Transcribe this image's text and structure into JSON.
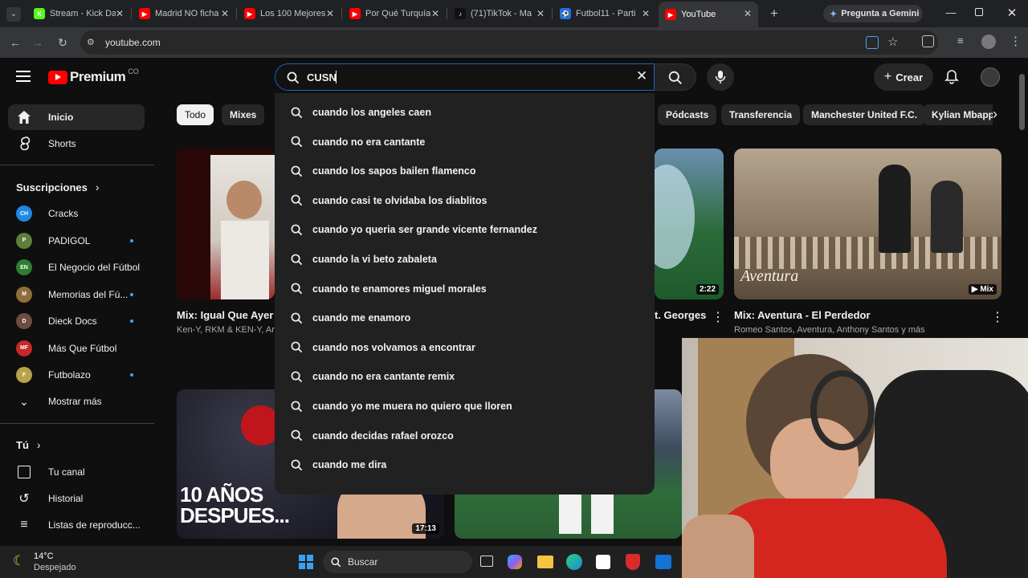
{
  "browser": {
    "tabs": [
      {
        "title": "Stream - Kick Da",
        "color": "#53fc18",
        "glyph": "K"
      },
      {
        "title": "Madrid NO ficha",
        "color": "#ff0000",
        "glyph": "▶"
      },
      {
        "title": "Los 100 Mejores",
        "color": "#ff0000",
        "glyph": "▶"
      },
      {
        "title": "Por Qué Turquía",
        "color": "#ff0000",
        "glyph": "▶"
      },
      {
        "title": "(71)TikTok - Ma",
        "color": "#111111",
        "glyph": "♪"
      },
      {
        "title": "Futbol11 - Parti",
        "color": "#1a73e8",
        "glyph": "⚽"
      },
      {
        "title": "YouTube",
        "color": "#ff0000",
        "glyph": "▶"
      }
    ],
    "gemini_label": "Pregunta a Gemini",
    "url": "youtube.com"
  },
  "youtube": {
    "logo_text": "Premium",
    "logo_suffix": "CO",
    "search_value": "CUSN",
    "create_label": "Crear",
    "suggestions": [
      "cuando los angeles caen",
      "cuando no era cantante",
      "cuando los sapos bailen flamenco",
      "cuando casi te olvidaba los diablitos",
      "cuando yo queria ser grande vicente fernandez",
      "cuando la vi beto zabaleta",
      "cuando te enamores miguel morales",
      "cuando me enamoro",
      "cuando nos volvamos a encontrar",
      "cuando no era cantante remix",
      "cuando yo me muera no quiero que lloren",
      "cuando decidas rafael orozco",
      "cuando me dira"
    ],
    "chips": [
      "Todo",
      "Mixes",
      "Pódcasts",
      "Transferencia",
      "Manchester United F.C.",
      "Kylian Mbapp"
    ],
    "sidebar": {
      "home": "Inicio",
      "shorts": "Shorts",
      "subs_header": "Suscripciones",
      "subs": [
        {
          "label": "Cracks",
          "avatar": "CH",
          "color": "#1e88e5",
          "new": false
        },
        {
          "label": "PADIGOL",
          "avatar": "P",
          "color": "#5d7f3a",
          "new": true
        },
        {
          "label": "El Negocio del Fútbol",
          "avatar": "EN",
          "color": "#2e7d32",
          "new": false
        },
        {
          "label": "Memorias del Fú...",
          "avatar": "M",
          "color": "#8d6e3b",
          "new": true
        },
        {
          "label": "Dieck Docs",
          "avatar": "D",
          "color": "#6d4c41",
          "new": true
        },
        {
          "label": "Más Que Fútbol",
          "avatar": "MF",
          "color": "#c62828",
          "new": false
        },
        {
          "label": "Futbolazo",
          "avatar": "F",
          "color": "#b8a24a",
          "new": true
        }
      ],
      "show_more": "Mostrar más",
      "you_header": "Tú",
      "you": [
        "Tu canal",
        "Historial",
        "Listas de reproducc..."
      ]
    },
    "videos": {
      "v1_title": "Mix: Igual Que Ayer",
      "v1_meta": "Ken-Y, RKM & KEN-Y, Ar",
      "v2_title_tail": "t. Georges",
      "v2_duration": "2:22",
      "v3_title": "Mix: Aventura - El Perdedor",
      "v3_meta": "Romeo Santos, Aventura, Anthony Santos y más",
      "v3_badge": "Mix",
      "v3_overlay": "Aventura",
      "v4_overlay": "10 AÑOS DESPUES...",
      "v4_duration": "17:13"
    }
  },
  "taskbar": {
    "temp": "14°C",
    "weather": "Despejado",
    "search": "Buscar"
  }
}
